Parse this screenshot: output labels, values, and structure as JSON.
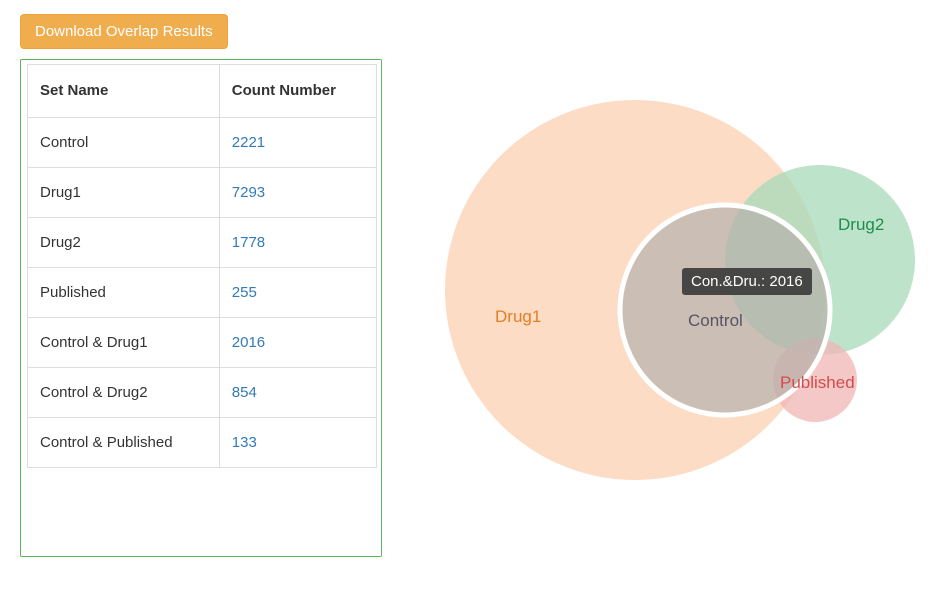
{
  "button": {
    "download_label": "Download Overlap Results"
  },
  "table": {
    "headers": {
      "name": "Set Name",
      "count": "Count Number"
    },
    "rows": [
      {
        "name": "Control",
        "count": "2221"
      },
      {
        "name": "Drug1",
        "count": "7293"
      },
      {
        "name": "Drug2",
        "count": "1778"
      },
      {
        "name": "Published",
        "count": "255"
      },
      {
        "name": "Control & Drug1",
        "count": "2016"
      },
      {
        "name": "Control & Drug2",
        "count": "854"
      },
      {
        "name": "Control & Published",
        "count": "133"
      }
    ]
  },
  "venn": {
    "labels": {
      "drug1": "Drug1",
      "control": "Control",
      "drug2": "Drug2",
      "published": "Published"
    },
    "colors": {
      "drug1": "#fbd6bb",
      "control": "#b7b0ad",
      "drug2": "#a7d9b8",
      "published": "#f1b6b6",
      "control_stroke": "#ffffff"
    },
    "tooltip": "Con.&Dru.: 2016"
  },
  "chart_data": {
    "type": "venn",
    "title": "",
    "sets": [
      {
        "name": "Control",
        "size": 2221,
        "color": "#7f8c8d"
      },
      {
        "name": "Drug1",
        "size": 7293,
        "color": "#e67e22"
      },
      {
        "name": "Drug2",
        "size": 1778,
        "color": "#27ae60"
      },
      {
        "name": "Published",
        "size": 255,
        "color": "#e74c3c"
      }
    ],
    "intersections": [
      {
        "sets": [
          "Control",
          "Drug1"
        ],
        "size": 2016
      },
      {
        "sets": [
          "Control",
          "Drug2"
        ],
        "size": 854
      },
      {
        "sets": [
          "Control",
          "Published"
        ],
        "size": 133
      }
    ],
    "highlighted_tooltip": {
      "sets": [
        "Control",
        "Drug1"
      ],
      "label": "Con.&Dru.",
      "value": 2016
    }
  }
}
